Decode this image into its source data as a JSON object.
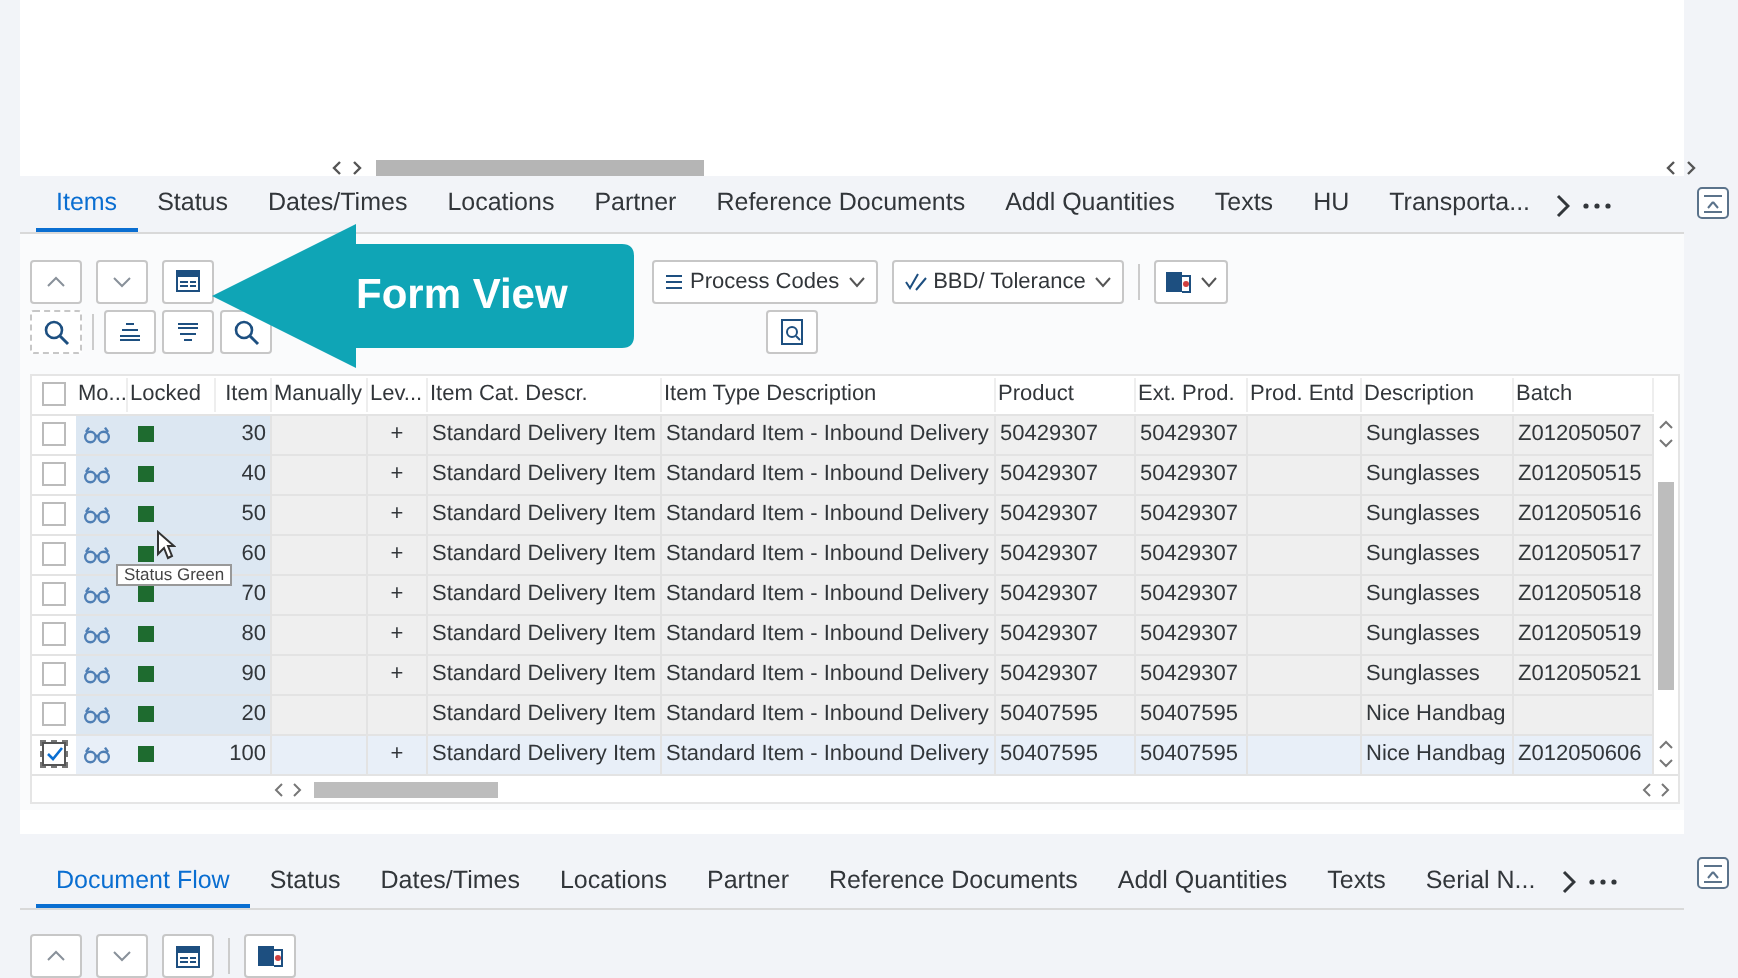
{
  "top_tabs": [
    {
      "label": "Items",
      "selected": true
    },
    {
      "label": "Status",
      "selected": false
    },
    {
      "label": "Dates/Times",
      "selected": false
    },
    {
      "label": "Locations",
      "selected": false
    },
    {
      "label": "Partner",
      "selected": false
    },
    {
      "label": "Reference Documents",
      "selected": false
    },
    {
      "label": "Addl Quantities",
      "selected": false
    },
    {
      "label": "Texts",
      "selected": false
    },
    {
      "label": "HU",
      "selected": false
    },
    {
      "label": "Transporta...",
      "selected": false
    }
  ],
  "toolbar": {
    "dropdowns": [
      "Process Codes",
      "BBD/ Tolerance"
    ]
  },
  "table": {
    "all_selected": false,
    "columns": [
      "Mo...",
      "Locked",
      "Item",
      "Manually",
      "Lev...",
      "Item Cat. Descr.",
      "Item Type Description",
      "Product",
      "Ext. Prod.",
      "Prod. Entd",
      "Description",
      "Batch"
    ],
    "rows": [
      {
        "selected": false,
        "color": "#1e6b2f",
        "item": "30",
        "level": "+",
        "item_cat": "Standard Delivery Item",
        "item_type": "Standard Item - Inbound Delivery",
        "product": "50429307",
        "ext_prod": "50429307",
        "description": "Sunglasses",
        "batch": "Z012050507"
      },
      {
        "selected": false,
        "color": "#1e6b2f",
        "item": "40",
        "level": "+",
        "item_cat": "Standard Delivery Item",
        "item_type": "Standard Item - Inbound Delivery",
        "product": "50429307",
        "ext_prod": "50429307",
        "description": "Sunglasses",
        "batch": "Z012050515"
      },
      {
        "selected": false,
        "color": "#1e6b2f",
        "item": "50",
        "level": "+",
        "item_cat": "Standard Delivery Item",
        "item_type": "Standard Item - Inbound Delivery",
        "product": "50429307",
        "ext_prod": "50429307",
        "description": "Sunglasses",
        "batch": "Z012050516"
      },
      {
        "selected": false,
        "color": "#1e6b2f",
        "item": "60",
        "level": "+",
        "item_cat": "Standard Delivery Item",
        "item_type": "Standard Item - Inbound Delivery",
        "product": "50429307",
        "ext_prod": "50429307",
        "description": "Sunglasses",
        "batch": "Z012050517"
      },
      {
        "selected": false,
        "color": "#1e6b2f",
        "item": "70",
        "level": "+",
        "item_cat": "Standard Delivery Item",
        "item_type": "Standard Item - Inbound Delivery",
        "product": "50429307",
        "ext_prod": "50429307",
        "description": "Sunglasses",
        "batch": "Z012050518"
      },
      {
        "selected": false,
        "color": "#1e6b2f",
        "item": "80",
        "level": "+",
        "item_cat": "Standard Delivery Item",
        "item_type": "Standard Item - Inbound Delivery",
        "product": "50429307",
        "ext_prod": "50429307",
        "description": "Sunglasses",
        "batch": "Z012050519"
      },
      {
        "selected": false,
        "color": "#1e6b2f",
        "item": "90",
        "level": "+",
        "item_cat": "Standard Delivery Item",
        "item_type": "Standard Item - Inbound Delivery",
        "product": "50429307",
        "ext_prod": "50429307",
        "description": "Sunglasses",
        "batch": "Z012050521"
      },
      {
        "selected": false,
        "color": "#1e6b2f",
        "item": "20",
        "item_cat": "Standard Delivery Item",
        "item_type": "Standard Item - Inbound Delivery",
        "product": "50407595",
        "ext_prod": "50407595",
        "description": "Nice Handbag"
      },
      {
        "selected": true,
        "color": "#1e6b2f",
        "item": "100",
        "level": "+",
        "item_cat": "Standard Delivery Item",
        "item_type": "Standard Item - Inbound Delivery",
        "product": "50407595",
        "ext_prod": "50407595",
        "description": "Nice Handbag",
        "batch": "Z012050606"
      }
    ]
  },
  "tooltip": "Status Green",
  "callout": "Form View",
  "bottom_tabs": [
    {
      "label": "Document Flow",
      "selected": true
    },
    {
      "label": "Status",
      "selected": false
    },
    {
      "label": "Dates/Times",
      "selected": false
    },
    {
      "label": "Locations",
      "selected": false
    },
    {
      "label": "Partner",
      "selected": false
    },
    {
      "label": "Reference Documents",
      "selected": false
    },
    {
      "label": "Addl Quantities",
      "selected": false
    },
    {
      "label": "Texts",
      "selected": false
    },
    {
      "label": "Serial N...",
      "selected": false
    }
  ]
}
